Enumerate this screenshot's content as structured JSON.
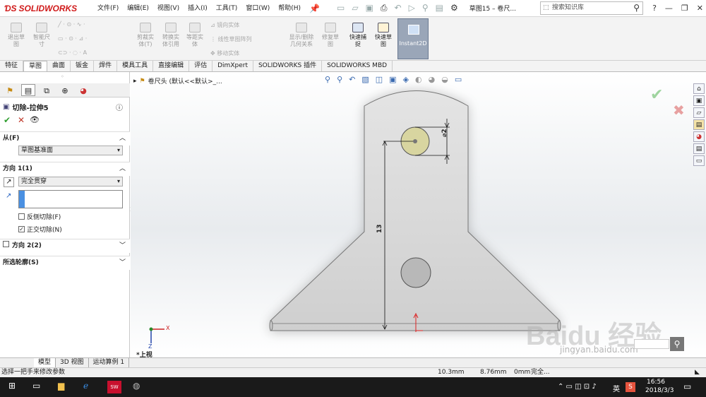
{
  "titlebar": {
    "logo": "SOLIDWORKS",
    "menu": [
      "文件(F)",
      "编辑(E)",
      "视图(V)",
      "插入(I)",
      "工具(T)",
      "窗口(W)",
      "帮助(H)"
    ],
    "doc_title": "草图15 – 卷尺...",
    "search_placeholder": "搜索知识库"
  },
  "ribbon": {
    "items": [
      {
        "label": "退出草\n图"
      },
      {
        "label": "智能尺\n寸"
      },
      {
        "label": "剪裁实\n体(T)"
      },
      {
        "label": "转换实\n体引用"
      },
      {
        "label": "等距实\n体"
      },
      {
        "label": "镜向实体"
      },
      {
        "label": "线性草图阵列"
      },
      {
        "label": "移动实体"
      },
      {
        "label": "显示/删除\n几何关系"
      },
      {
        "label": "修复草\n图"
      },
      {
        "label": "快速捕\n捉"
      },
      {
        "label": "快速草\n图"
      },
      {
        "label": "Instant2D"
      }
    ]
  },
  "tabs": [
    "特征",
    "草图",
    "曲面",
    "钣金",
    "焊件",
    "模具工具",
    "直接编辑",
    "评估",
    "DimXpert",
    "SOLIDWORKS 插件",
    "SOLIDWORKS MBD"
  ],
  "active_tab": "草图",
  "property_manager": {
    "title": "切除-拉伸5",
    "from_label": "从(F)",
    "from_value": "草图基准面",
    "dir1_label": "方向 1(1)",
    "dir1_value": "完全贯穿",
    "flip_side_label": "反侧切除(F)",
    "normal_cut_label": "正交切除(N)",
    "dir2_label": "方向 2(2)",
    "contours_label": "所选轮廓(S)"
  },
  "tree": {
    "part_label": "卷尺头 (默认<<默认>_..."
  },
  "drawing": {
    "dim_diameter": "⌀2",
    "dim_height": "13",
    "view_label": "*上视",
    "axis_x": "X",
    "axis_z": "Z"
  },
  "bottom_tabs": [
    "模型",
    "3D 视图",
    "运动算例 1"
  ],
  "status": {
    "message": "选择一把手来修改参数",
    "x": "10.3mm",
    "y": "8.76mm",
    "z": "0mm",
    "state": "完全..."
  },
  "taskbar": {
    "time": "16:56",
    "date": "2018/3/3",
    "ime": "英"
  },
  "watermark": {
    "text": "Baidu 经验",
    "url": "jingyan.baidu.com"
  },
  "colors": {
    "accent": "#d01a1a",
    "part_fill": "#d9d9d9",
    "hole_fill": "#d8d5a0",
    "dim_line": "#111111",
    "confirm_green": "#2f9e2f",
    "cancel_red": "#c0392b"
  }
}
